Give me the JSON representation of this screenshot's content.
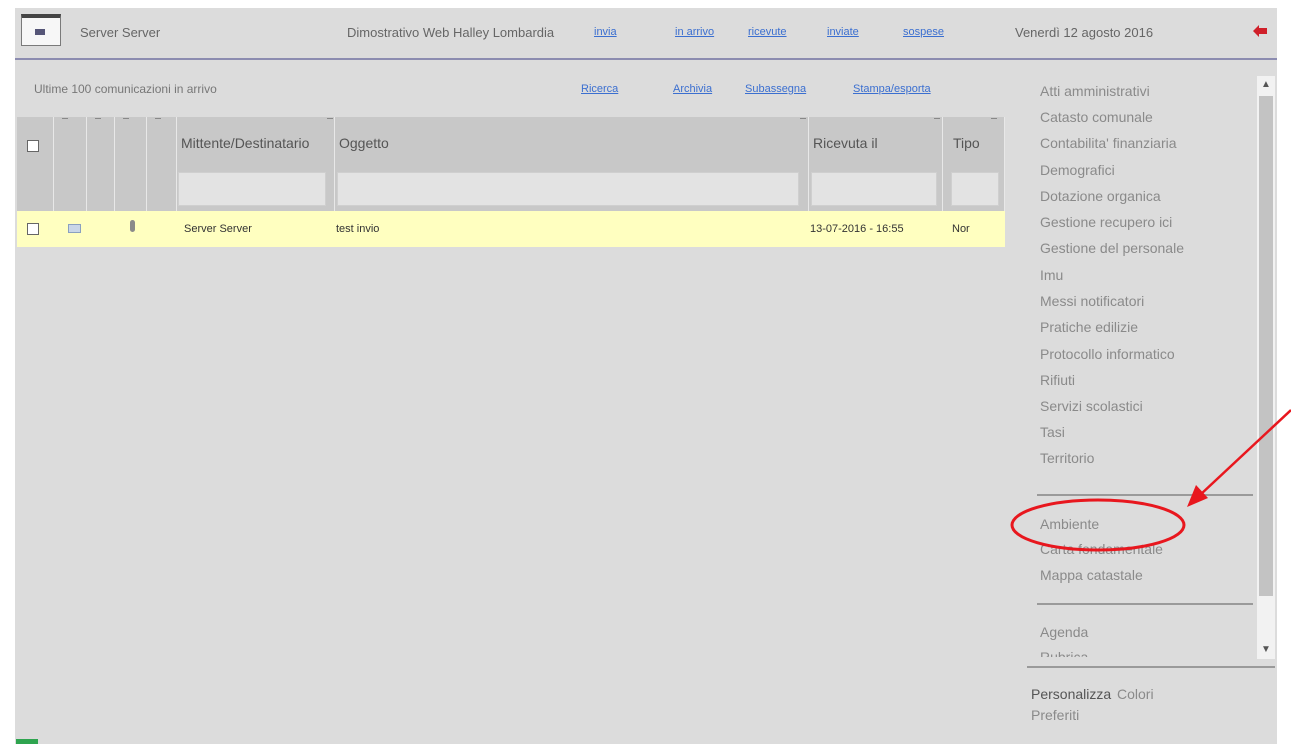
{
  "header": {
    "user": "Server Server",
    "organization": "Dimostrativo Web Halley Lombardia",
    "links": [
      "invia",
      "in arrivo",
      "ricevute",
      "inviate",
      "sospese"
    ],
    "date": "Venerdì 12 agosto 2016",
    "accent": "#8c8cb0",
    "exit_color": "#d0202a"
  },
  "list": {
    "title": "Ultime 100 comunicazioni in arrivo",
    "actions": [
      "Ricerca",
      "Archivia",
      "Subassegna",
      "Stampa/esporta"
    ],
    "columns": {
      "sender": "Mittente/Destinatario",
      "subject": "Oggetto",
      "received": "Ricevuta il",
      "type": "Tipo"
    },
    "rows": [
      {
        "sender": "Server Server",
        "subject": "test invio",
        "received": "13-07-2016 - 16:55",
        "type": "Nor",
        "highlight": "#ffffc0"
      }
    ]
  },
  "sidebar": {
    "modules": [
      "Atti amministrativi",
      "Catasto comunale",
      "Contabilita' finanziaria",
      "Demografici",
      "Dotazione organica",
      "Gestione recupero ici",
      "Gestione del personale",
      "Imu",
      "Messi notificatori",
      "Pratiche edilizie",
      "Protocollo informatico",
      "Rifiuti",
      "Servizi scolastici",
      "Tasi",
      "Territorio"
    ],
    "maps": [
      "Ambiente",
      "Carta fondamentale",
      "Mappa catastale"
    ],
    "tools": [
      "Agenda",
      "Rubrica"
    ],
    "personalize": "Personalizza",
    "colors": "Colori",
    "favorites": "Preferiti"
  },
  "annotation": {
    "color": "#e8171e"
  }
}
